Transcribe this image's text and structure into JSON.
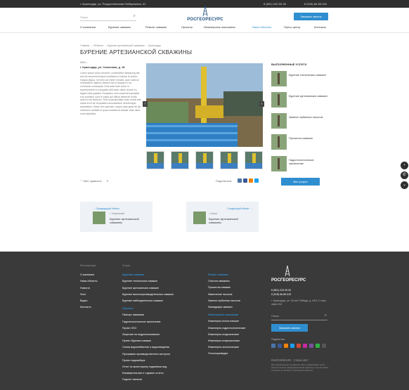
{
  "topbar": {
    "address": "г. Краснодар, ул. Рождественская Набережная, 41",
    "phone1": "8 (861) 242-09-30",
    "phone2": "8 (918) 66-66-316"
  },
  "header": {
    "search_placeholder": "Поиск",
    "logo_text": "РОСГЕОРЕСУРС",
    "call_button": "Заказать звонок"
  },
  "nav": {
    "items": [
      "О компании",
      "Бурение скважин",
      "Ремонт скважин",
      "Проекты",
      "Инженерные изыскания",
      "Наши объекты",
      "Пресс-центр",
      "Контакты"
    ],
    "active": "Наши объекты"
  },
  "breadcrumbs": "Главная  →  Объекты  →  Бурение артезианской скважины  →  Краснодар",
  "page": {
    "title": "БУРЕНИЕ АРТЕЗИАНСКОЙ СКВАЖИНЫ",
    "year": "2011 г.",
    "location": "г. Краснодар, ул. Совхозная, д. 18",
    "body": "Lorem ipsum dolor sit amet, consectetur adipiscing elit, sed do eiusmod tempor incididunt ut labore et dolore magna aliqua. Ut enim ad minim veniam, quis nostrud exercitation ullamco laboris nisi ut aliquip ex ea commodo consequat. Duis aute irure dolor in reprehenderit in voluptate velit esse cillum dolore eu fugiat nulla pariatur. Excepteur sint occaecat cupidatat non proident, sunt in culpa qui officia deserunt mollit anim id est laborum. Sed ut perspiciatis unde omnis iste natus error sit voluptatem accusantium doloremque laudantium, totam rem aperiam, eaque ipsa quae ab illo inventore veritatis et quasi architecto beatae vitae dicta sunt explicabo.",
    "likes_label": "Мне нравится",
    "likes_count": "3",
    "share_label": "Поделиться:",
    "all_services": "Все услуги"
  },
  "sidebar": {
    "title": "ВЫПОЛНЕННЫЕ УСЛУГИ",
    "items": [
      "Бурение технических скважин",
      "Бурение артезианских скважин",
      "Замена глубинных насосов",
      "Прочистка скважин",
      "Гидрогеологическое заключение"
    ]
  },
  "object_nav": {
    "prev_caption": "Предыдущий объект",
    "prev_location": "г. Темрюкский",
    "prev_title": "Бурение артезианской скважины",
    "next_caption": "Следующий объект",
    "next_location": "г. Анапа",
    "next_title": "Бурение артезианской скважины"
  },
  "footer": {
    "col1_title": "Росгеоресурс",
    "col1": [
      "О компании",
      "Наши объекты",
      "Новости",
      "Фото",
      "Видео",
      "Контакты"
    ],
    "col2_title": "Услуги",
    "col2_head1": "Бурение скважин",
    "col2a": [
      "Бурение технических скважин",
      "Бурение артезианских скважин",
      "Бурение высокопроизводительных скважин",
      "Бурение наблюдательных скважин"
    ],
    "col2_head2": "Проекты",
    "col2b": [
      "Паспорт скважины",
      "Гидрогеологическое заключение",
      "Проект ЗСО",
      "Лицензия на недропользование",
      "Проект бурения скважин",
      "Схема водоснабжения и водоотведения",
      "Программа производственного контроля",
      "Проект водозабора",
      "Отчет по мониторингу подземных вод",
      "Ежеквартальные и годовые отчеты",
      "Подсчет запасов"
    ],
    "col3_head1": "Ремонт скважин",
    "col3a": [
      "Очистка скважины",
      "Прочистка скважин",
      "Извлечение насосов",
      "Замена глубинных насосов",
      "Ликвидация скважин"
    ],
    "col3_head2": "Инженерные изыскания",
    "col3b": [
      "Инженерно-геологические",
      "Инженерно-гидрогеологические",
      "Инженерно-геодезические",
      "Инженерно-геофизические",
      "Инженерно-экологические",
      "Геологоразведка"
    ],
    "logo_text": "РОСГЕОРЕСУРС",
    "phone1": "8 (861) 242-09-30",
    "phone2": "8 (918) 66-66-316",
    "address": "г. Краснодар, ул. 30-лет Победы, д. 34/3, 2 этаж, офис 202",
    "search_placeholder": "Поиск",
    "call_button": "Заказать звонок",
    "share_label": "Поделиться",
    "copyright": "РОСГЕОРЕСУРС · © 2010–2017",
    "disclaimer": "Вся размещенная на данном сайте информация носит исключительно информационный характер и ни при каких условиях не является публичной офертой."
  },
  "colors": {
    "accent": "#2f8ecf",
    "dark": "#3a3a3a",
    "topbar": "#2f2f2f"
  }
}
